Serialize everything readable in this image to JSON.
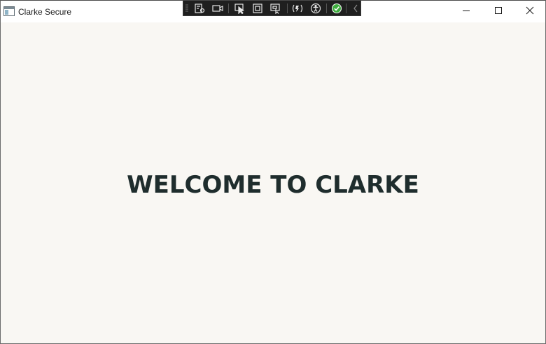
{
  "window": {
    "title": "Clarke Secure",
    "app_icon": "window-app-icon",
    "controls": {
      "minimize": "minimize-icon",
      "maximize": "maximize-icon",
      "close": "close-icon"
    }
  },
  "debug_toolbar": {
    "tools": [
      "live-visual-tree-icon",
      "record-icon",
      "select-element-icon",
      "display-layout-adorners-icon",
      "track-focus-icon",
      "hot-reload-icon",
      "accessibility-checker-icon",
      "binding-failures-ok-icon",
      "collapse-chevron-icon"
    ]
  },
  "main": {
    "heading": "WELCOME TO CLARKE"
  },
  "colors": {
    "background": "#f9f7f3",
    "heading": "#1f2d2d",
    "titlebar": "#ffffff",
    "toolbar": "#1f1f1f",
    "check_green": "#3fae3f"
  }
}
